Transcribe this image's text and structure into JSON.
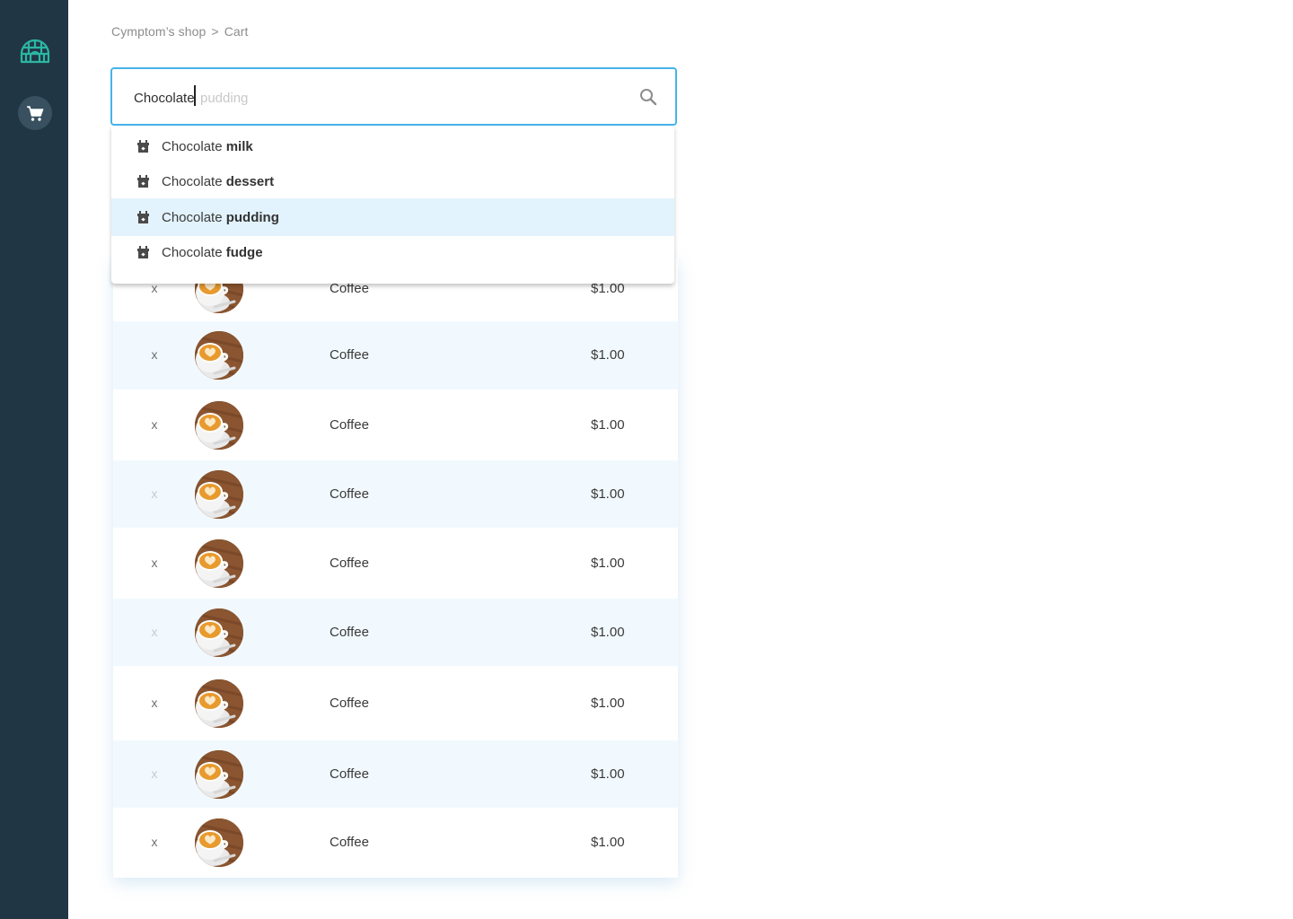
{
  "sidebar": {
    "logo_icon": "igloo-icon",
    "cart_icon": "shopping-cart-icon",
    "accent": "#2bb6a3",
    "background": "#213645"
  },
  "breadcrumb": {
    "shop": "Cymptom’s shop",
    "separator": ">",
    "current": "Cart"
  },
  "search": {
    "typed_value": "Chocolate",
    "autocomplete_hint": "pudding",
    "icon": "search-icon",
    "border_color": "#46b3ea",
    "suggestions": [
      {
        "prefix": "Chocolate",
        "match": "milk",
        "icon": "gift-box-icon",
        "highlighted": false
      },
      {
        "prefix": "Chocolate",
        "match": "dessert",
        "icon": "gift-box-icon",
        "highlighted": false
      },
      {
        "prefix": "Chocolate",
        "match": "pudding",
        "icon": "gift-box-icon",
        "highlighted": true
      },
      {
        "prefix": "Chocolate",
        "match": "fudge",
        "icon": "gift-box-icon",
        "highlighted": false
      }
    ]
  },
  "cart": {
    "remove_label": "x",
    "items": [
      {
        "name": "Coffee",
        "price": "$1.00",
        "image": "latte-art-cup"
      },
      {
        "name": "Coffee",
        "price": "$1.00",
        "image": "latte-art-cup"
      },
      {
        "name": "Coffee",
        "price": "$1.00",
        "image": "latte-art-cup"
      },
      {
        "name": "Coffee",
        "price": "$1.00",
        "image": "latte-art-cup"
      },
      {
        "name": "Coffee",
        "price": "$1.00",
        "image": "latte-art-cup"
      },
      {
        "name": "Coffee",
        "price": "$1.00",
        "image": "latte-art-cup"
      },
      {
        "name": "Coffee",
        "price": "$1.00",
        "image": "latte-art-cup"
      },
      {
        "name": "Coffee",
        "price": "$1.00",
        "image": "latte-art-cup"
      },
      {
        "name": "Coffee",
        "price": "$1.00",
        "image": "latte-art-cup"
      }
    ]
  }
}
